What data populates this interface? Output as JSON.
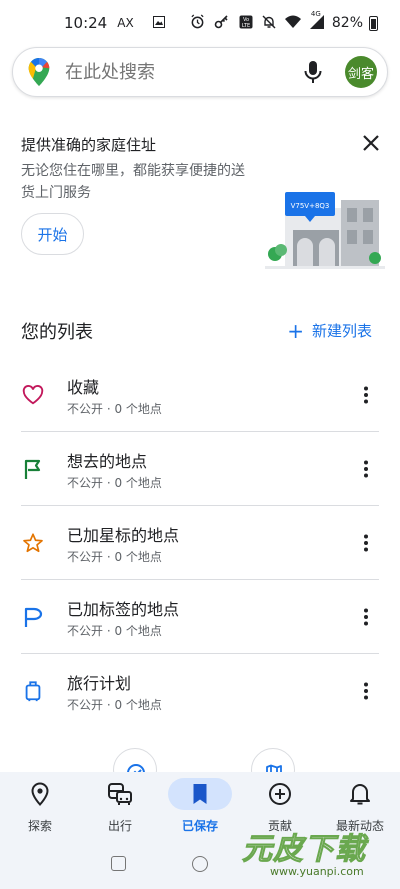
{
  "status_bar": {
    "time": "10:24",
    "ax_label": "AX",
    "signal_label": "4G",
    "battery_percent": "82%"
  },
  "search": {
    "placeholder": "在此处搜索",
    "avatar_text": "剑客"
  },
  "promo": {
    "title": "提供准确的家庭住址",
    "body": "无论您住在哪里，都能获享便捷的送货上门服务",
    "button_label": "开始",
    "illustration_code": "V75V+8Q3"
  },
  "lists": {
    "header": "您的列表",
    "new_list_label": "新建列表",
    "items": [
      {
        "title": "收藏",
        "subtitle": "不公开 · 0 个地点",
        "icon": "heart-icon",
        "color": "#c2185b"
      },
      {
        "title": "想去的地点",
        "subtitle": "不公开 · 0 个地点",
        "icon": "flag-icon",
        "color": "#188038"
      },
      {
        "title": "已加星标的地点",
        "subtitle": "不公开 · 0 个地点",
        "icon": "star-icon",
        "color": "#e37400"
      },
      {
        "title": "已加标签的地点",
        "subtitle": "不公开 · 0 个地点",
        "icon": "label-flag-icon",
        "color": "#1a73e8"
      },
      {
        "title": "旅行计划",
        "subtitle": "不公开 · 0 个地点",
        "icon": "suitcase-icon",
        "color": "#1a73e8"
      }
    ]
  },
  "bottom_nav": {
    "items": [
      {
        "label": "探索",
        "icon": "location-pin-icon"
      },
      {
        "label": "出行",
        "icon": "commute-icon"
      },
      {
        "label": "已保存",
        "icon": "bookmark-icon",
        "active": true
      },
      {
        "label": "贡献",
        "icon": "add-circle-icon"
      },
      {
        "label": "最新动态",
        "icon": "bell-icon"
      }
    ]
  },
  "watermark": {
    "main": "元皮下载",
    "sub": "www.yuanpi.com"
  },
  "colors": {
    "accent": "#1a73e8",
    "active_nav_bg": "#d3e3fd",
    "nav_bg": "#f1f4f9"
  }
}
